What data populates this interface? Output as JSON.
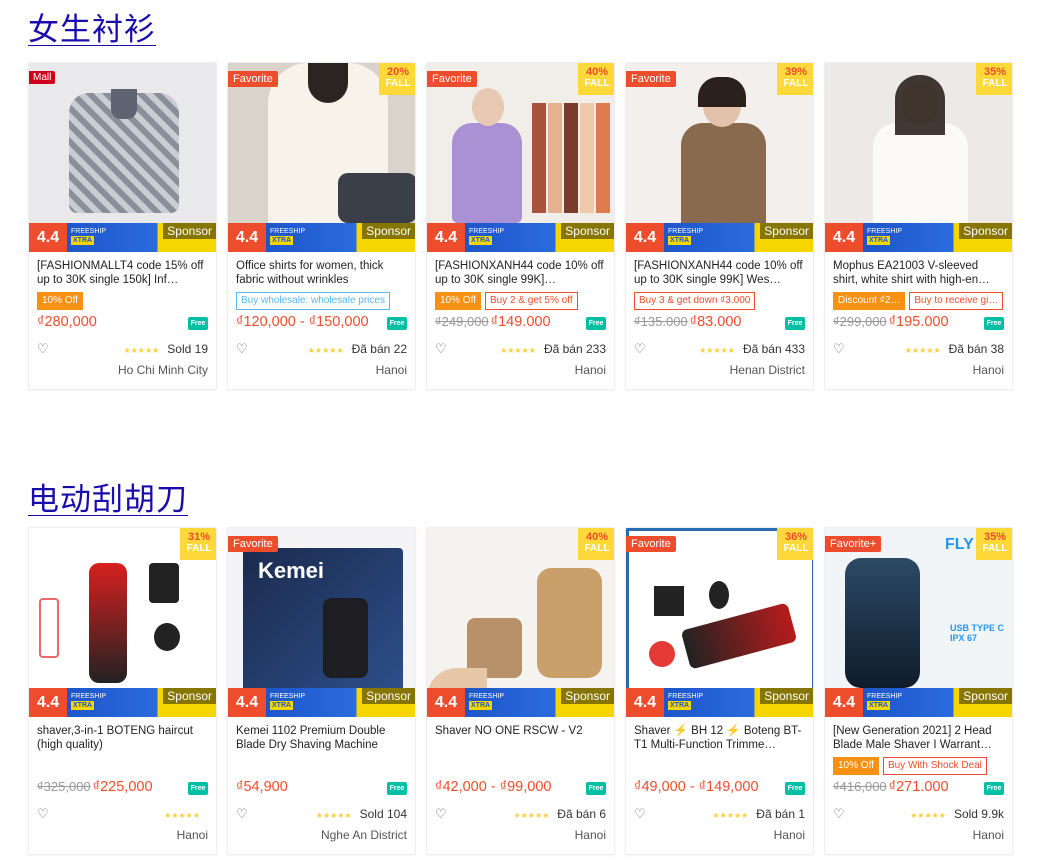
{
  "sections": [
    {
      "title": "女生衬衫",
      "cards": [
        {
          "ribbon": "Mall",
          "ribbon_type": "mall",
          "discount": "",
          "title": "[FASHIONMALLT4 code 15% off up to 30K single 150k] Inf…",
          "tags": [
            {
              "text": "10% Off",
              "style": "solid"
            }
          ],
          "old_price": "",
          "price": "₫280,000",
          "sold": "Sold 19",
          "location": "Ho Chi Minh City",
          "sponsor": "Sponsor",
          "img": "shirt-print"
        },
        {
          "ribbon": "Favorite",
          "ribbon_type": "fav",
          "discount": "20%",
          "title": "Office shirts for women, thick fabric without wrinkles",
          "tags": [
            {
              "text": "Buy wholesale: wholesale prices",
              "style": "blue"
            }
          ],
          "old_price": "",
          "price": "₫120,000 - ₫150,000",
          "sold": "Đã bán 22",
          "location": "Hanoi",
          "sponsor": "Sponsor",
          "img": "white-blouse"
        },
        {
          "ribbon": "Favorite",
          "ribbon_type": "fav",
          "discount": "40%",
          "title": "[FASHIONXANH44 code 10% off up to 30K single 99K]…",
          "tags": [
            {
              "text": "10% Off",
              "style": "solid"
            },
            {
              "text": "Buy 2 & get 5% off",
              "style": "outline"
            }
          ],
          "old_price": "₫249,000",
          "price": "₫149.000",
          "sold": "Đã bán 233",
          "location": "Hanoi",
          "sponsor": "Sponsor",
          "img": "purple-shirt"
        },
        {
          "ribbon": "Favorite",
          "ribbon_type": "fav",
          "discount": "39%",
          "title": "[FASHIONXANH44 code 10% off up to 30K single 99K] Wes…",
          "tags": [
            {
              "text": "Buy 3 & get down ₫3.000",
              "style": "outline"
            }
          ],
          "old_price": "₫135.000",
          "price": "₫83.000",
          "sold": "Đã bán 433",
          "location": "Henan District",
          "sponsor": "Sponsor",
          "img": "brown-shirt"
        },
        {
          "ribbon": "",
          "ribbon_type": "",
          "discount": "35%",
          "title": "Mophus EA21003 V-sleeved shirt, white shirt with high-en…",
          "tags": [
            {
              "text": "Discount ₫2…",
              "style": "solid"
            },
            {
              "text": "Buy to receive gi…",
              "style": "outline"
            }
          ],
          "old_price": "₫299,000",
          "price": "₫195.000",
          "sold": "Đã bán 38",
          "location": "Hanoi",
          "sponsor": "Sponsor",
          "img": "white-shirt"
        }
      ]
    },
    {
      "title": "电动刮胡刀",
      "cards": [
        {
          "ribbon": "",
          "ribbon_type": "",
          "discount": "31%",
          "title": "shaver,3-in-1 BOTENG haircut (high quality)",
          "tags": [],
          "old_price": "₫325,000",
          "price": "₫225,000",
          "sold": "",
          "location": "Hanoi",
          "sponsor": "Sponsor",
          "img": "red-shaver"
        },
        {
          "ribbon": "Favorite",
          "ribbon_type": "fav",
          "discount": "",
          "title": "Kemei 1102 Premium Double Blade Dry Shaving Machine",
          "tags": [],
          "old_price": "",
          "price": "₫54,900",
          "sold": "Sold 104",
          "location": "Nghe An District",
          "sponsor": "Sponsor",
          "img": "kemei-box"
        },
        {
          "ribbon": "",
          "ribbon_type": "",
          "discount": "40%",
          "title": "Shaver NO ONE RSCW - V2",
          "tags": [],
          "old_price": "",
          "price": "₫42,000 - ₫99,000",
          "sold": "Đã bán 6",
          "location": "Hanoi",
          "sponsor": "Sponsor",
          "img": "gold-shaver"
        },
        {
          "ribbon": "Favorite",
          "ribbon_type": "fav",
          "discount": "36%",
          "title": "Shaver ⚡ BH 12 ⚡ Boteng BT- T1 Multi-Function Trimme…",
          "tags": [],
          "old_price": "",
          "price": "₫49,000 - ₫149,000",
          "sold": "Đã bán 1",
          "location": "Hanoi",
          "sponsor": "Sponsor",
          "img": "boteng-kit"
        },
        {
          "ribbon": "Favorite+",
          "ribbon_type": "fav",
          "discount": "35%",
          "title": "[New Generation 2021] 2 Head Blade Male Shaver I Warrant…",
          "tags": [
            {
              "text": "10% Off",
              "style": "solid"
            },
            {
              "text": "Buy With Shock Deal",
              "style": "outline"
            }
          ],
          "old_price": "₫416,000",
          "price": "₫271.000",
          "sold": "Sold 9.9k",
          "location": "Hanoi",
          "sponsor": "Sponsor",
          "img": "fly-shaver"
        }
      ]
    }
  ],
  "promo": {
    "badge": "4.4",
    "freeship": "FREESHIP",
    "xtra": "XTRA",
    "fall": "FALL"
  },
  "colors": {
    "accent": "#ee4d2d",
    "link": "#1a0dab",
    "stars": "#ffce3d",
    "freeship": "#00bfa5"
  }
}
